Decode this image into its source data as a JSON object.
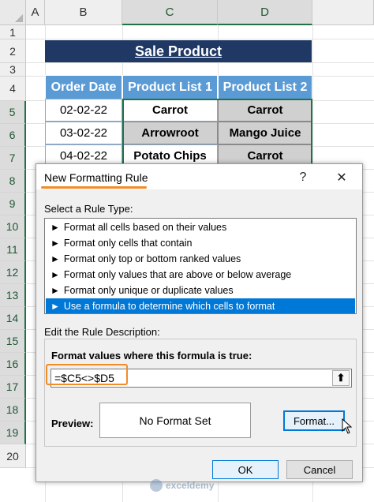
{
  "sheet": {
    "columns": [
      "A",
      "B",
      "C",
      "D"
    ],
    "rows": [
      "1",
      "2",
      "3",
      "4",
      "5",
      "6",
      "7",
      "8",
      "9",
      "10",
      "11",
      "12",
      "13",
      "14",
      "15",
      "16",
      "17",
      "18",
      "19",
      "20"
    ],
    "title": "Sale Product",
    "headers": [
      "Order Date",
      "Product List 1",
      "Product List 2"
    ],
    "data": [
      [
        "02-02-22",
        "Carrot",
        "Carrot"
      ],
      [
        "03-02-22",
        "Arrowroot",
        "Mango Juice"
      ],
      [
        "04-02-22",
        "Potato Chips",
        "Carrot"
      ]
    ],
    "colors": {
      "title_bg": "#1f3864",
      "header_bg": "#5b9bd5",
      "grey_cell": "#d0d0d0",
      "selection": "#217346"
    }
  },
  "dialog": {
    "title": "New Formatting Rule",
    "help": "?",
    "close": "✕",
    "select_label": "Select a Rule Type:",
    "rule_types": [
      "Format all cells based on their values",
      "Format only cells that contain",
      "Format only top or bottom ranked values",
      "Format only values that are above or below average",
      "Format only unique or duplicate values",
      "Use a formula to determine which cells to format"
    ],
    "selected_rule_index": 5,
    "edit_label": "Edit the Rule Description:",
    "formula_label": "Format values where this formula is true:",
    "formula_value": "=$C5<>$D5",
    "collapse_icon": "⬆",
    "preview_label": "Preview:",
    "preview_text": "No Format Set",
    "format_button": "Format...",
    "ok": "OK",
    "cancel": "Cancel",
    "highlight_color": "#f28c28",
    "accent": "#0078d7"
  },
  "watermark": {
    "text": "exceldemy"
  }
}
